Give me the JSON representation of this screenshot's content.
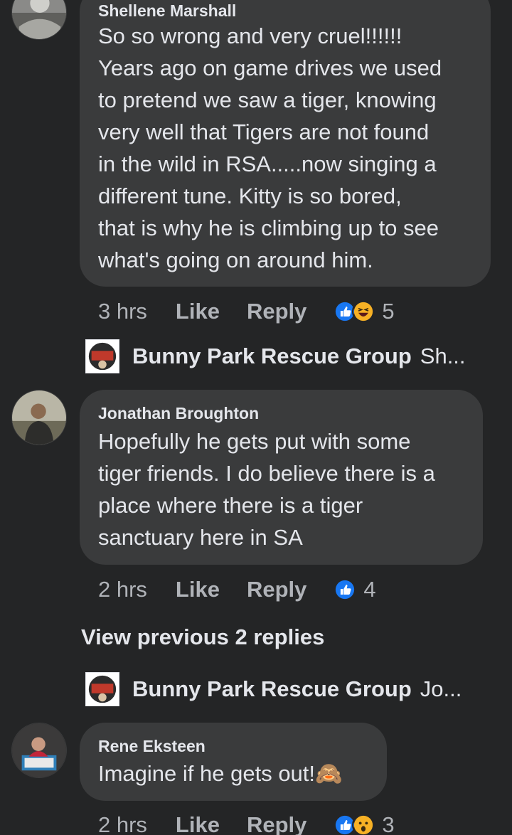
{
  "comments": [
    {
      "author": "Shellene Marshall",
      "text": "So so wrong and very cruel!!!!!!\nYears ago on game drives we used\nto pretend we saw a tiger, knowing\nvery well that Tigers are not found\nin the wild in RSA.....now singing a\ndifferent tune.  Kitty is so bored,\nthat is why he is climbing up to see\nwhat's going on around him.",
      "time": "3 hrs",
      "like_label": "Like",
      "reply_label": "Reply",
      "reactions": [
        "like-reaction-icon",
        "haha-reaction-icon"
      ],
      "reaction_count": "5"
    },
    {
      "author": "Jonathan Broughton",
      "text": "Hopefully he gets put with some\ntiger friends. I do believe there is a\nplace where there is a tiger\nsanctuary here in SA",
      "time": "2 hrs",
      "like_label": "Like",
      "reply_label": "Reply",
      "reactions": [
        "like-reaction-icon"
      ],
      "reaction_count": "4"
    },
    {
      "author": "Rene Eksteen",
      "text": "Imagine if he gets out!🙈",
      "time": "2 hrs",
      "like_label": "Like",
      "reply_label": "Reply",
      "reactions": [
        "like-reaction-icon",
        "wow-reaction-icon"
      ],
      "reaction_count": "3"
    }
  ],
  "page_replies": [
    {
      "name": "Bunny Park Rescue Group",
      "snippet": "Sh..."
    },
    {
      "name": "Bunny Park Rescue Group",
      "snippet": "Jo..."
    }
  ],
  "view_previous": "View previous 2 replies",
  "colors": {
    "background": "#242526",
    "bubble": "#3a3b3c",
    "text": "#e4e6eb",
    "secondary_text": "#b0b3b8",
    "like_blue": "#1877f2",
    "haha_yellow": "#f7b125"
  }
}
